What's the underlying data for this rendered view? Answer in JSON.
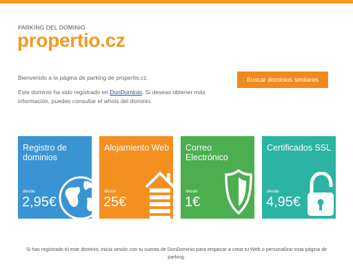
{
  "header": {
    "kicker": "PARKING DEL DOMINIO",
    "domain": "propertio.cz"
  },
  "intro": {
    "welcome": "Bienvenido a la página de parking de propertio.cz.",
    "desc_before": "Este dominio ha sido registrado en ",
    "desc_link": "DonDominio",
    "desc_after": ". Si deseas obtener más información, puedes consultar el whois del dominio."
  },
  "cta": {
    "label": "Buscar dominios similares"
  },
  "cards": [
    {
      "title": "Registro de dominios",
      "from": "desde",
      "price": "2,95€",
      "icon": "globe-icon",
      "color": "#3a93d3"
    },
    {
      "title": "Alojamiento Web",
      "from": "desde",
      "price": "25€",
      "icon": "house-icon",
      "color": "#f3901f"
    },
    {
      "title": "Correo Electrónico",
      "from": "desde",
      "price": "1€",
      "icon": "shield-icon",
      "color": "#4cae4f"
    },
    {
      "title": "Certificados SSL",
      "from": "desde",
      "price": "4,95€",
      "icon": "padlock-icon",
      "color": "#2bb4a2"
    }
  ],
  "footer": {
    "text": "Si has registrado tú este dominio, inicia sesión con tu cuenta de DonDominio para empezar a crear tu Web o personalizar esta página de parking."
  },
  "colors": {
    "accent": "#f39a1c",
    "link": "#1f4f99"
  }
}
